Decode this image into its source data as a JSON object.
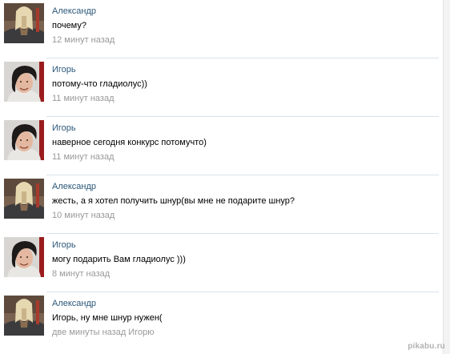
{
  "messages": [
    {
      "author": "Александр",
      "avatar": "alexander",
      "text": "почему?",
      "time": "12 минут назад"
    },
    {
      "author": "Игорь",
      "avatar": "igor",
      "text": "потому-что гладиолус))",
      "time": "11 минут назад"
    },
    {
      "author": "Игорь",
      "avatar": "igor",
      "text": "наверное сегодня конкурс потомучто)",
      "time": "11 минут назад"
    },
    {
      "author": "Александр",
      "avatar": "alexander",
      "text": "жесть, а я хотел получить шнур(вы мне не подарите шнур?",
      "time": "10 минут назад"
    },
    {
      "author": "Игорь",
      "avatar": "igor",
      "text": "могу подарить Вам гладиолус )))",
      "time": "8 минут назад"
    },
    {
      "author": "Александр",
      "avatar": "alexander",
      "text": "Игорь, ну мне шнур нужен(",
      "time": "две минуты назад Игорю"
    }
  ],
  "watermark": "pikabu.ru",
  "colors": {
    "author_link": "#2b587a",
    "time": "#999999",
    "divider": "#dae1e8"
  }
}
